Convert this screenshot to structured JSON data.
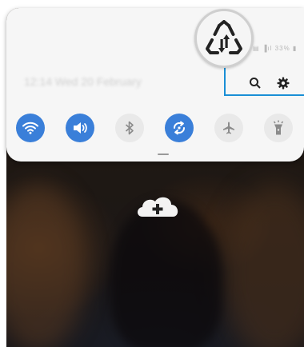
{
  "status_bar": {
    "text": "▤ ▐ıl 33% ▮"
  },
  "panel": {
    "date_time": "12:14 Wed 20 February",
    "search_icon": "search-icon",
    "settings_icon": "gear-icon"
  },
  "quick_toggles": [
    {
      "icon": "wifi-icon",
      "state": "on"
    },
    {
      "icon": "volume-icon",
      "state": "on"
    },
    {
      "icon": "bluetooth-icon",
      "state": "off"
    },
    {
      "icon": "auto-rotate-icon",
      "state": "on"
    },
    {
      "icon": "airplane-icon",
      "state": "off"
    },
    {
      "icon": "flashlight-icon",
      "state": "off"
    }
  ],
  "zoom_icon": "data-saver-icon",
  "callout_color": "#1a8fd6",
  "accent_color": "#3a7fd9",
  "home": {
    "cloud_icon": "cloud-add-icon"
  }
}
